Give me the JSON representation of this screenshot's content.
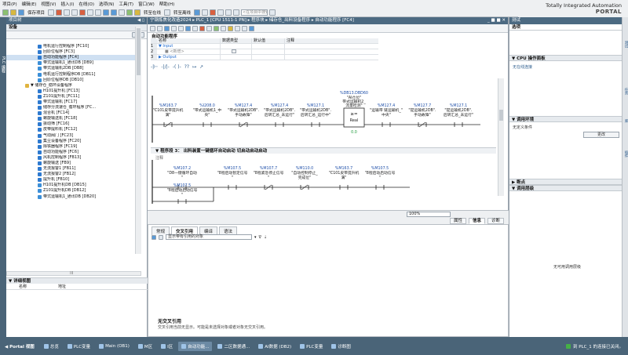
{
  "menu": {
    "items": [
      "项目(P)",
      "编辑(E)",
      "视图(V)",
      "插入(I)",
      "在线(O)",
      "选项(N)",
      "工具(T)",
      "窗口(W)",
      "帮助(H)"
    ]
  },
  "toolbar": {
    "save_label": "保存项目",
    "online_label": "转至在线",
    "offline_label": "转至离线",
    "search_placeholder": "<在项目中搜索>"
  },
  "brand": {
    "line1": "Totally Integrated Automation",
    "line2": "PORTAL"
  },
  "left_panel": {
    "vertical_tab": "PLC 编程",
    "title": "项目树",
    "subtab": "设备",
    "tree_items": [
      {
        "label": "电机运行控制程序 [FC10]",
        "icon": "fc",
        "indent": 60
      },
      {
        "label": "回原位程序 [FC3]",
        "icon": "fc",
        "indent": 60
      },
      {
        "label": "自动功能程序 [FC4]",
        "icon": "fc",
        "indent": 60,
        "selected": true
      },
      {
        "label": "带式运输机1_通讯DB [DB9]",
        "icon": "db",
        "indent": 60
      },
      {
        "label": "带式运输机2DB [DB8]",
        "icon": "db",
        "indent": 60
      },
      {
        "label": "电机运行控制程序DB [DB11]",
        "icon": "db",
        "indent": 60
      },
      {
        "label": "回原位程序DB [DB10]",
        "icon": "db",
        "indent": 60
      },
      {
        "label": "▼ 储存仓_循环设备程序",
        "icon": "fold",
        "indent": 44
      },
      {
        "label": "H101提升机 [FC13]",
        "icon": "fc",
        "indent": 60
      },
      {
        "label": "Z101提升机 [FC11]",
        "icon": "fc",
        "indent": 60
      },
      {
        "label": "带式运输机 [FC17]",
        "icon": "fc",
        "indent": 60
      },
      {
        "label": "储存分流速仓_循环程序 [FC...",
        "icon": "fc",
        "indent": 60
      },
      {
        "label": "混合机 [FC14]",
        "icon": "fc",
        "indent": 60
      },
      {
        "label": "螺旋输送机 [FC18]",
        "icon": "fc",
        "indent": 60
      },
      {
        "label": "振动筛 [FC16]",
        "icon": "fc",
        "indent": 60
      },
      {
        "label": "皮带提料机 [FC12]",
        "icon": "fc",
        "indent": 60
      },
      {
        "label": "气动阀门 [FC23]",
        "icon": "fc",
        "indent": 60
      },
      {
        "label": "集尘设备程序 [FC20]",
        "icon": "fc",
        "indent": 60
      },
      {
        "label": "除铁器程序 [FC19]",
        "icon": "fc",
        "indent": 60
      },
      {
        "label": "自动功能程序 [FC6]",
        "icon": "fc",
        "indent": 60
      },
      {
        "label": "风机控制程序 [FB13]",
        "icon": "fc",
        "indent": 60
      },
      {
        "label": "螺旋输送 [FB9]",
        "icon": "fc",
        "indent": 60
      },
      {
        "label": "无流报警1 [FB11]",
        "icon": "fc",
        "indent": 60
      },
      {
        "label": "无流报警2 [FB12]",
        "icon": "fc",
        "indent": 60
      },
      {
        "label": "提升机 [FB10]",
        "icon": "fc",
        "indent": 60
      },
      {
        "label": "H101提升机DB [DB15]",
        "icon": "db",
        "indent": 60
      },
      {
        "label": "Z101提升机DB [DB12]",
        "icon": "db",
        "indent": 60
      },
      {
        "label": "带式运输机1_通讯DB [DB20]",
        "icon": "db",
        "indent": 60
      }
    ],
    "hscroll_label": "III",
    "detail_title": "▼ 详细视图",
    "detail_cols": [
      "名称",
      "地址"
    ]
  },
  "editor": {
    "breadcrumb": "宁钢炼焦化改造2024 ▸ PLC_1 [CPU 1511-1 PN] ▸ 程序块 ▸ 储存仓_出料设备程序 ▸ 自动功能程序 [FC4]",
    "window_controls": "_ ■ ■ ✕",
    "block_title": "自动功能程序",
    "interface_cols": [
      "名称",
      "数据类型",
      "默认值",
      "注释"
    ],
    "interface_rows": [
      {
        "num": "1",
        "name": "▼ Input"
      },
      {
        "num": "2",
        "name": "■ <新增>"
      },
      {
        "num": "3",
        "name": "▶ Output"
      }
    ],
    "lad_tools": [
      "-|⊢",
      "-|/|-",
      "-( )-",
      "??",
      "↦",
      "↗"
    ],
    "network_top_labels": [
      {
        "addr": "%M163.7",
        "text": "\"C101皮带提升机",
        "text2": "满\""
      },
      {
        "addr": "%I208.0",
        "text": "\"带式运输机1_中",
        "text2": "央\""
      },
      {
        "addr": "%M127.4",
        "text": "\"带式运输机2DB\".",
        "text2": "手动故障\""
      },
      {
        "addr": "%M127.4",
        "text": "\"带式运输机2DB\".",
        "text2": "后转汇总_未运行\""
      },
      {
        "addr": "%M127.1",
        "text": "\"带式运输机2DB\".",
        "text2": "后转汇总_运行中\""
      },
      {
        "addr": "%M127.4",
        "text": "\"运输带 链运输机_\"",
        "text2": "中央\""
      },
      {
        "addr": "%M127.7",
        "text": "\"提运输机2DB\".",
        "text2": "手动故障\""
      },
      {
        "addr": "%M127.1",
        "text": "\"提运输机2DB\".",
        "text2": "后转汇总_未运行\""
      }
    ],
    "compare_block": {
      "addr": "%DB13.DBD60",
      "name": "\"AI仓位\"",
      "name2": "带式运输机2_",
      "name3": "流量检测\"",
      "op": "≥=",
      "type": "Real",
      "value": "0.0"
    },
    "network3_title": "▼   程序段 3：  出料装置一键循环自动启动   切启动启动启动",
    "network3_comment": "注释",
    "network3_labels": [
      {
        "addr": "%M107.2",
        "text": "\"D8一键循环自动",
        "text2": "\""
      },
      {
        "addr": "%M107.5",
        "text": "\"8程启动暂定信号",
        "text2": "\""
      },
      {
        "addr": "%M107.7",
        "text": "\"8程紧急停止信号",
        "text2": "\""
      },
      {
        "addr": "%M110.0",
        "text": "\"自动控制停止_",
        "text2": "完成位\""
      },
      {
        "addr": "%M163.7",
        "text": "\"C101皮带提升机",
        "text2": "满\""
      },
      {
        "addr": "%M107.5",
        "text": "\"8程启动启动信号",
        "text2": "\""
      }
    ],
    "network3_branch": {
      "addr": "%M107.5",
      "text": "\"8程启动启动信号",
      "text2": "\""
    },
    "zoom": "100%"
  },
  "inspector": {
    "tabs": [
      "属性",
      "信息",
      "诊断"
    ],
    "subtabs": [
      "常规",
      "交叉引用",
      "编译",
      "语法"
    ],
    "filter_label": "显示带有引用的对象",
    "no_ref_title": "无交叉引用",
    "no_ref_desc": "交叉引用当前无显示。可能是未选择对象或者对象无交叉引用。"
  },
  "right_panel": {
    "title": "测试",
    "options_label": "选项",
    "cpu_panel": "▼ CPU 操作面板",
    "cpu_status": "无在线连接",
    "call_env": "▼ 调用环境",
    "call_env_field": "无定义条件",
    "change_button": "更改",
    "breakpoints": "▶ 断点",
    "call_stack": "▼ 调用层级",
    "no_call_stack": "无可用调用层级",
    "vtabs": [
      "测试",
      "任务",
      "库",
      "插件"
    ]
  },
  "taskbar": {
    "portal_view": "◀ Portal 视图",
    "items": [
      "总览",
      "PLC变量",
      "Main (OB1)",
      "M区",
      "I区",
      "自动功能...",
      "二区数据通...",
      "AI数据 (DB2)",
      "PLC变量",
      "诊断图"
    ],
    "active_index": 5,
    "status": "到 PLC_1 的连接已关闭。"
  }
}
